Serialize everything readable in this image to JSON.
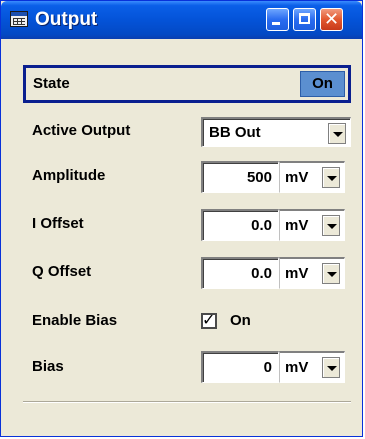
{
  "window": {
    "title": "Output",
    "app_icon": "table-icon",
    "buttons": {
      "minimize_icon": "minimize-icon",
      "maximize_icon": "maximize-icon",
      "close_icon": "close-icon",
      "close_glyph": "✕"
    }
  },
  "state": {
    "label": "State",
    "value": "On"
  },
  "active_output": {
    "label": "Active Output",
    "value": "BB Out"
  },
  "amplitude": {
    "label": "Amplitude",
    "value": "500",
    "unit": "mV"
  },
  "i_offset": {
    "label": "I Offset",
    "value": "0.0",
    "unit": "mV"
  },
  "q_offset": {
    "label": "Q Offset",
    "value": "0.0",
    "unit": "mV"
  },
  "enable_bias": {
    "label": "Enable Bias",
    "checked": true,
    "check_glyph": "✓",
    "checkbox_label": "On"
  },
  "bias": {
    "label": "Bias",
    "value": "0",
    "unit": "mV"
  },
  "colors": {
    "titlebar": "#0453d8",
    "state_highlight_border": "#0a1f8f",
    "toggle_on": "#5b8fd0",
    "panel": "#ece9d8"
  }
}
